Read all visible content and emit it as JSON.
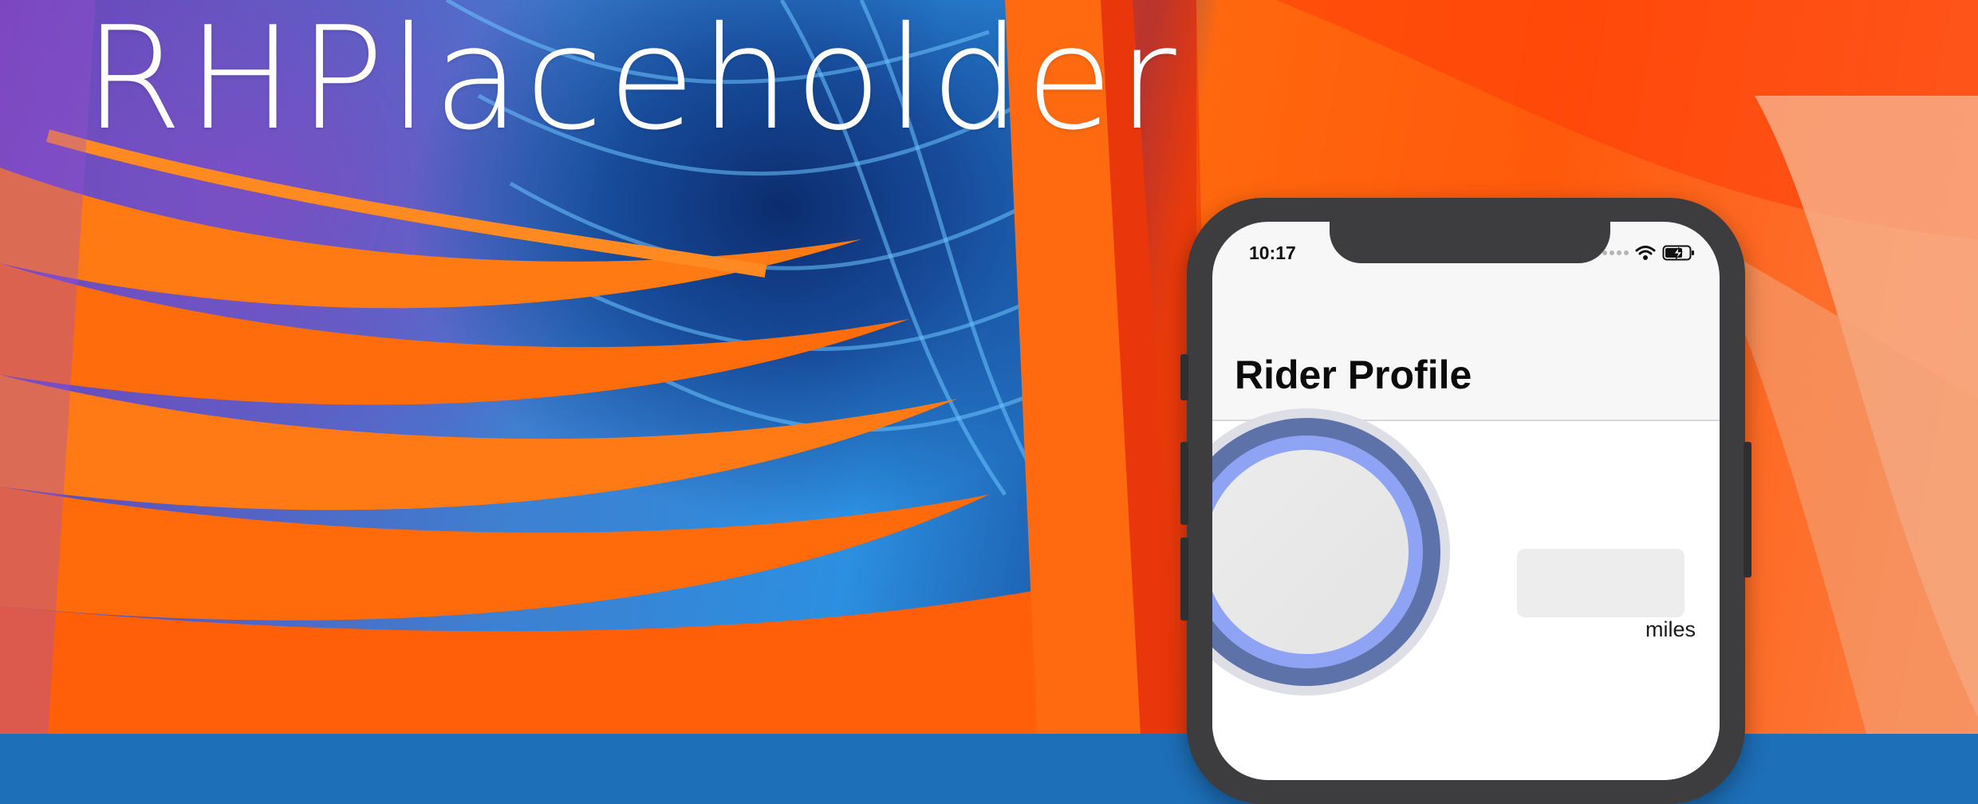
{
  "banner": {
    "title": "RHPlaceholder"
  },
  "status_bar": {
    "time": "10:17",
    "icons": [
      "signal-dots-icon",
      "wifi-icon",
      "battery-charging-icon"
    ]
  },
  "screen": {
    "nav_title": "Rider Profile",
    "avatar": {
      "icon": "avatar-placeholder"
    },
    "miles": {
      "value": "",
      "unit_label": "miles"
    }
  },
  "colors": {
    "wallpaper_orange": "#ff6a0a",
    "wallpaper_blue": "#1d5fb0",
    "wallpaper_purple": "#6a3fb4",
    "phone_frame": "#3d3d3f",
    "avatar_ring_dark": "#5d72a8",
    "avatar_ring_light": "#8ea3f4"
  }
}
